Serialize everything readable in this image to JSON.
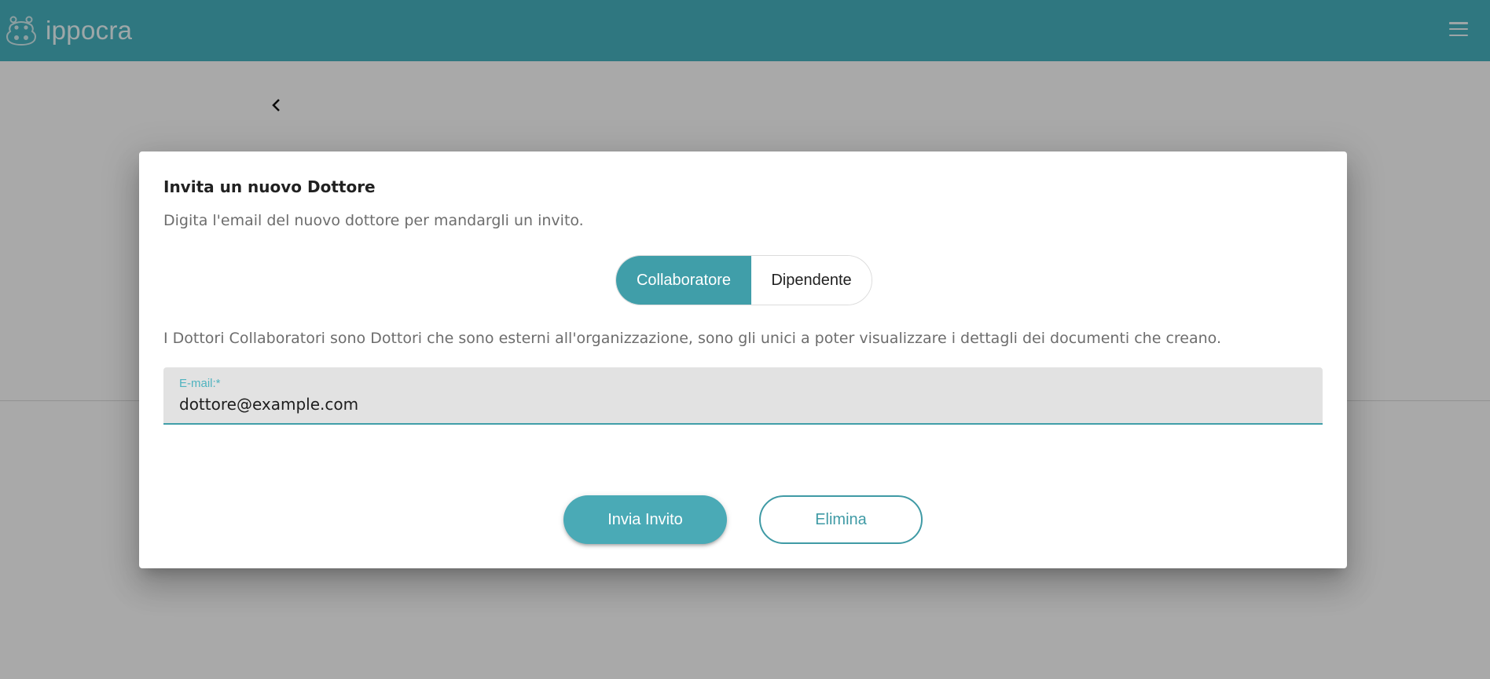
{
  "app": {
    "brand": "ippocra",
    "logo_icon": "hippo-icon",
    "menu_icon": "hamburger-menu-icon",
    "accent_color": "#409ea9",
    "topbar_color": "#46b0bd"
  },
  "page": {
    "back_icon": "chevron-left-icon"
  },
  "dialog": {
    "title": "Invita un nuovo Dottore",
    "subtitle": "Digita l'email del nuovo dottore per mandargli un invito.",
    "toggle": {
      "options": [
        "Collaboratore",
        "Dipendente"
      ],
      "selected": "Collaboratore"
    },
    "info": "I Dottori Collaboratori sono Dottori che sono esterni all'organizzazione, sono gli unici a poter visualizzare i dettagli dei documenti che creano.",
    "email_field": {
      "label": "E-mail:*",
      "value": "dottore@example.com"
    },
    "primary_button": "Invia Invito",
    "secondary_button": "Elimina"
  }
}
